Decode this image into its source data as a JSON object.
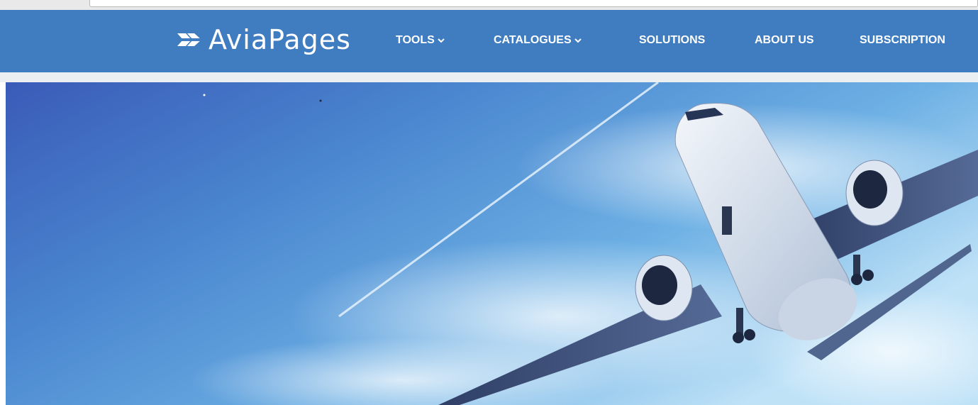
{
  "brand": {
    "name": "AviaPages"
  },
  "nav": {
    "items": [
      {
        "label": "TOOLS",
        "has_dropdown": true
      },
      {
        "label": "CATALOGUES",
        "has_dropdown": true
      },
      {
        "label": "SOLUTIONS",
        "has_dropdown": false
      },
      {
        "label": "ABOUT US",
        "has_dropdown": false
      },
      {
        "label": "SUBSCRIPTION",
        "has_dropdown": false
      }
    ]
  },
  "colors": {
    "header_bg": "#3f7cc0",
    "header_text": "#ffffff",
    "sky_dark": "#3a5bb8",
    "sky_light": "#bfe2f7"
  },
  "hero": {
    "image": "airplane-taking-off-blue-sky"
  }
}
